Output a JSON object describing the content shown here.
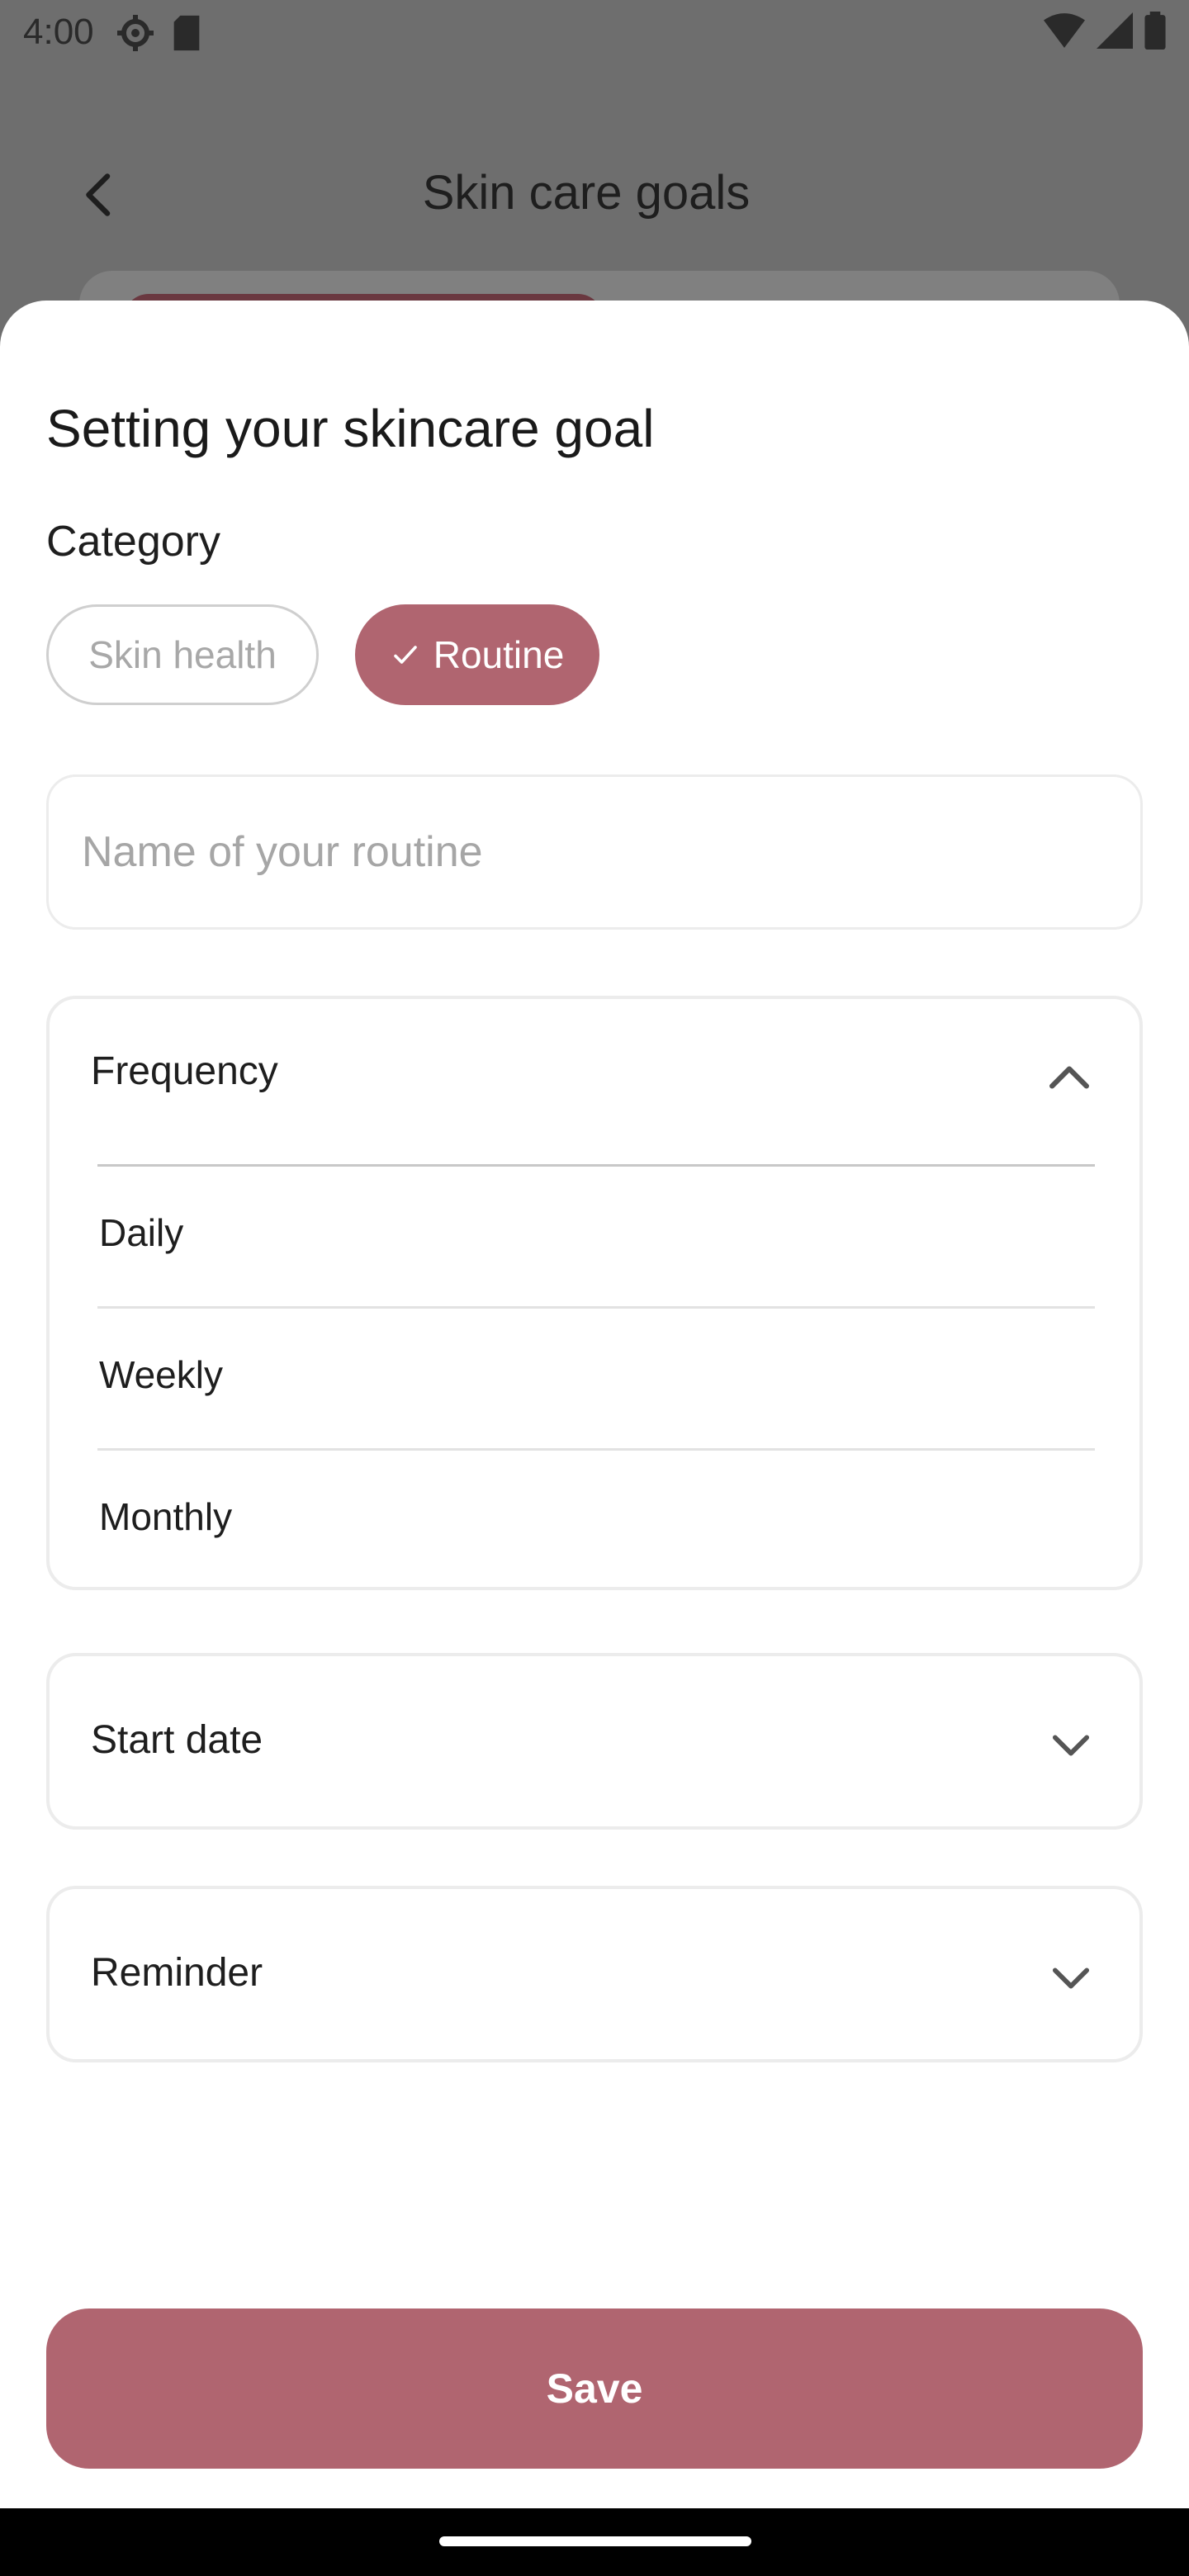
{
  "status_bar": {
    "time": "4:00"
  },
  "background_screen": {
    "title": "Skin care goals"
  },
  "sheet": {
    "title": "Setting your skincare goal",
    "category_label": "Category",
    "chips": [
      {
        "label": "Skin health",
        "selected": false
      },
      {
        "label": "Routine",
        "selected": true
      }
    ],
    "name_placeholder": "Name of your routine",
    "frequency": {
      "label": "Frequency",
      "expanded": true,
      "options": [
        "Daily",
        "Weekly",
        "Monthly"
      ]
    },
    "start_date_label": "Start date",
    "reminder_label": "Reminder",
    "save_label": "Save"
  },
  "colors": {
    "accent": "#b06570",
    "scrim": "#6e6e6e"
  },
  "icons": [
    "settings-icon",
    "sd-card-icon",
    "wifi-icon",
    "signal-icon",
    "battery-icon",
    "back-arrow-icon",
    "check-icon",
    "chevron-up-icon",
    "chevron-down-icon"
  ]
}
